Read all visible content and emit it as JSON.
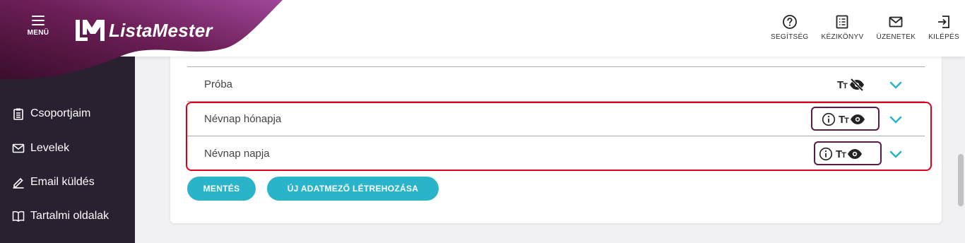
{
  "header": {
    "menu_label": "MENÜ",
    "brand": "ListaMester",
    "actions": [
      {
        "label": "SEGÍTSÉG",
        "icon": "help-circle-icon"
      },
      {
        "label": "KÉZIKÖNYV",
        "icon": "manual-list-icon"
      },
      {
        "label": "ÜZENETEK",
        "icon": "envelope-icon"
      },
      {
        "label": "KILÉPÉS",
        "icon": "logout-icon"
      }
    ]
  },
  "sidebar": {
    "items": [
      {
        "label": "Csoportjaim",
        "icon": "clipboard-icon"
      },
      {
        "label": "Levelek",
        "icon": "envelope-icon"
      },
      {
        "label": "Email küldés",
        "icon": "pencil-icon"
      },
      {
        "label": "Tartalmi oldalak",
        "icon": "book-icon"
      }
    ]
  },
  "fields": [
    {
      "label": "Próba",
      "icons": [
        "text-size-icon",
        "eye-off-icon"
      ]
    },
    {
      "label": "Névnap hónapja",
      "icons": [
        "info-icon",
        "text-size-icon",
        "eye-icon"
      ]
    },
    {
      "label": "Névnap napja",
      "icons": [
        "info-icon",
        "text-size-icon",
        "eye-icon"
      ]
    }
  ],
  "buttons": {
    "save": "MENTÉS",
    "new_field": "ÚJ ADATMEZŐ LÉTREHOZÁSA"
  },
  "colors": {
    "accent": "#2ab4c9",
    "brand_purple": "#5c1a46",
    "sidebar_bg": "#2a2130",
    "highlight": "#e0001b"
  }
}
